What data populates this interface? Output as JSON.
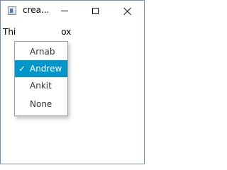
{
  "window": {
    "title": "crea...",
    "controls": {
      "minimize": "minimize-icon",
      "maximize": "maximize-icon",
      "close": "close-icon"
    }
  },
  "content": {
    "label_left": "Thi",
    "label_right": "ox"
  },
  "dropdown": {
    "items": [
      {
        "label": "Arnab",
        "selected": false
      },
      {
        "label": "Andrew",
        "selected": true
      },
      {
        "label": "Ankit",
        "selected": false
      },
      {
        "label": "None",
        "selected": false
      }
    ],
    "check_glyph": "✓",
    "selected_color": "#0096c9"
  }
}
